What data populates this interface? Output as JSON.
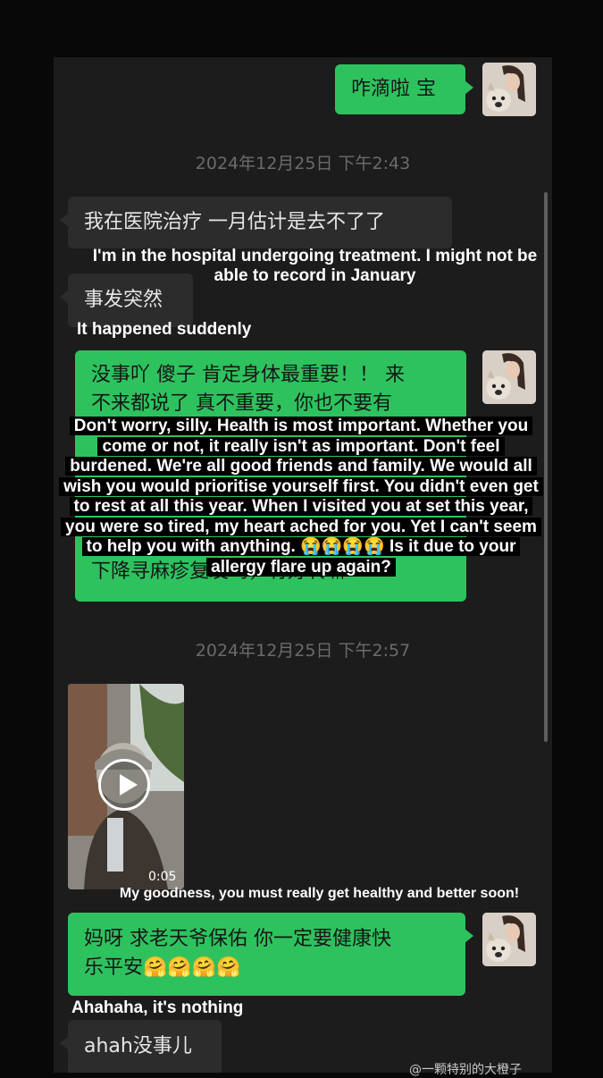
{
  "chat": {
    "timestamps": [
      "2024年12月25日 下午2:43",
      "2024年12月25日 下午2:57"
    ],
    "messages": {
      "m1": "咋滴啦 宝",
      "m2": "我在医院治疗 一月估计是去不了了",
      "m3": "事发突然",
      "m4_line1": "没事吖 傻子 肯定身体最重要！！ 来",
      "m4_line2": "不来都说了 真不重要，你也不要有",
      "m4_line_last": "下降寻麻疹复发吗，有好转嘛",
      "m5_line1": "妈呀 求老天爷保佑  你一定要健康快",
      "m5_line2": "乐平安🤗🤗🤗🤗",
      "m6": "ahah没事儿"
    },
    "video": {
      "duration": "0:05"
    }
  },
  "captions": {
    "c1_line1": "I'm in the hospital undergoing treatment. I might not be",
    "c1_line2": "able to record in January",
    "c2": "It happened suddenly",
    "c3_lines": [
      "Don't worry, silly. Health is most important. Whether you",
      "come or not, it really isn't as important. Don't feel",
      "burdened. We're all good friends and family. We would all",
      "wish you would prioritise yourself first. You didn't even get",
      "to rest at all this year. When I visited you at set this year,",
      "you were so tired, my heart ached for you. Yet I can't seem",
      "to help you with anything. 😭😭😭😭 Is it due to your",
      "allergy flare up again?"
    ],
    "c4": "My goodness, you must really get healthy and better soon!",
    "c5": "Ahahaha, it's nothing"
  },
  "watermark": "@一颗特别的大橙子",
  "colors": {
    "green_bubble": "#2ec25f",
    "gray_bubble": "#2c2c2c",
    "background": "#1c1c1c"
  }
}
